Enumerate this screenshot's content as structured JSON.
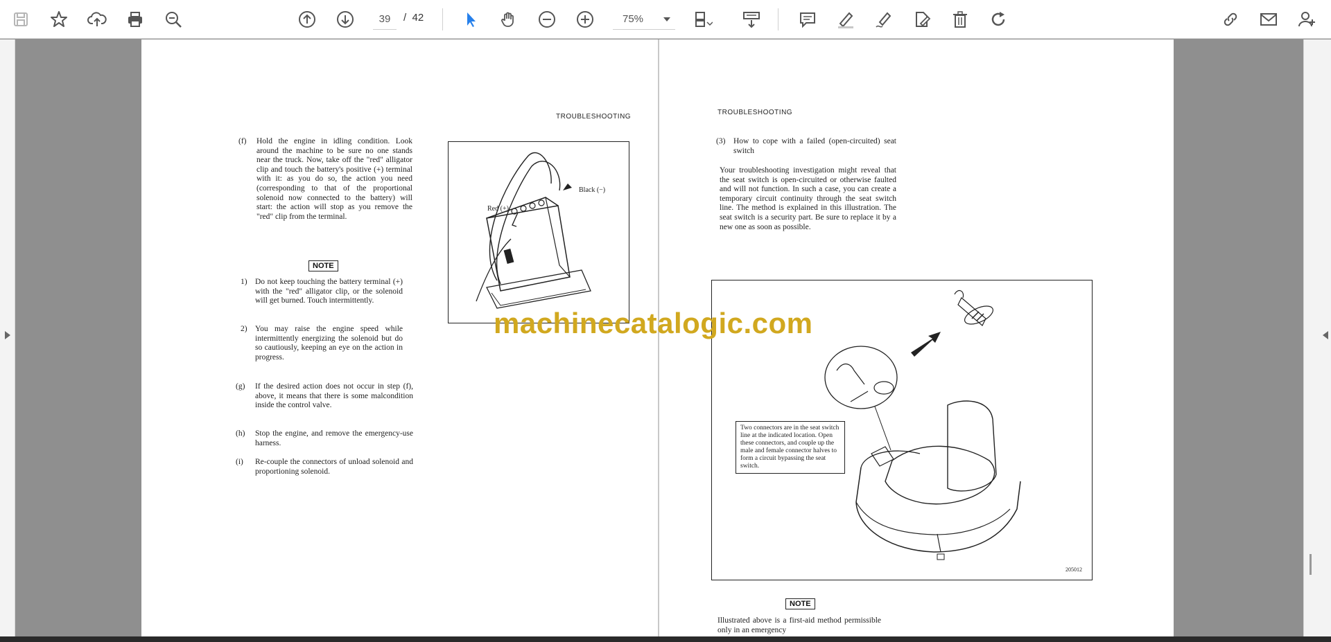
{
  "toolbar": {
    "left_icons": [
      "save-icon",
      "bookmark-star-icon",
      "upload-cloud-icon",
      "print-icon",
      "zoom-search-icon"
    ],
    "nav_icons": [
      "previous-page-icon",
      "next-page-icon"
    ],
    "current_page": "39",
    "page_separator": "/",
    "total_pages": "42",
    "zoom_icons": [
      "select-cursor-icon",
      "hand-pan-icon",
      "zoom-out-icon",
      "zoom-in-icon"
    ],
    "zoom_value": "75%",
    "right_icons": [
      "fit-page-icon",
      "scroll-mode-icon",
      "comment-icon",
      "highlight-pen-icon",
      "draw-sign-icon",
      "edit-pdf-icon",
      "delete-icon",
      "rotate-icon",
      "share-link-icon",
      "email-icon",
      "add-user-icon"
    ]
  },
  "left_page": {
    "header": "TROUBLESHOOTING",
    "items": [
      {
        "label": "(f)",
        "text": "Hold the engine in idling condition. Look around the machine to be sure no one stands near the truck. Now, take off the \"red\" alligator clip and touch the battery's positive (+) terminal with it: as you do so, the action you need (corresponding to that of the proportional solenoid now connected to the battery) will start: the action will stop as you remove the \"red\" clip from the terminal."
      },
      {
        "label": "1)",
        "text": "Do not keep touching the battery terminal (+) with the \"red\" alligator clip, or the solenoid will get burned. Touch intermittently."
      },
      {
        "label": "2)",
        "text": "You may raise the engine speed while intermittently energizing the solenoid but do so cautiously, keeping an eye on the action in progress."
      },
      {
        "label": "(g)",
        "text": "If the desired action does not occur in step (f), above, it means that there is some malcondition inside the control valve."
      },
      {
        "label": "(h)",
        "text": "Stop the engine, and remove the emergency-use harness."
      },
      {
        "label": "(i)",
        "text": "Re-couple the connectors of unload solenoid and proportioning solenoid."
      }
    ],
    "note_label": "NOTE",
    "figure": {
      "label_red": "Red (+)",
      "label_black": "Black (−)"
    }
  },
  "right_page": {
    "header": "TROUBLESHOOTING",
    "section_label": "(3)",
    "section_title": "How to cope with a failed (open-circuited) seat switch",
    "body": "Your troubleshooting investigation might reveal that the seat switch is open-circuited or otherwise faulted and will not function. In such a case, you can create a temporary circuit continuity through the seat switch line. The method is explained in this illustration. The seat switch is a security part. Be sure to replace it by a new one as soon as possible.",
    "figure": {
      "callout": "Two connectors are in the seat switch line at the indicated location. Open these connectors, and couple up the male and female connector halves to form a circuit bypassing the seat switch.",
      "figure_number": "205012"
    },
    "note_label": "NOTE",
    "note_text": "Illustrated above is a first-aid method permissible only in an emergency"
  },
  "watermark": "machinecatalogic.com"
}
